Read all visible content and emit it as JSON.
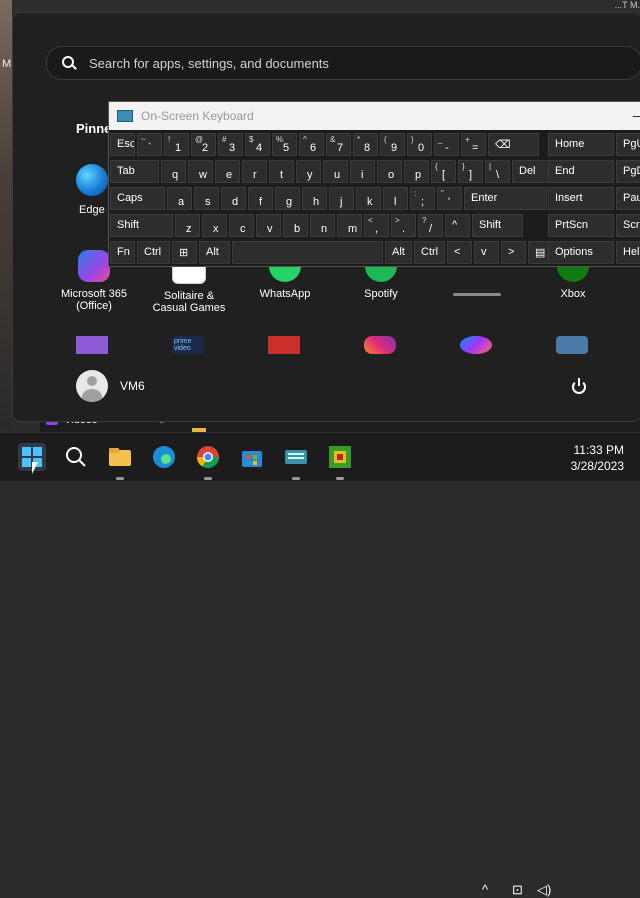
{
  "background": {
    "left_label": "M",
    "top_right_text": "...T M."
  },
  "start_menu": {
    "search_placeholder": "Search for apps, settings, and documents",
    "pinned_label": "Pinne",
    "apps": [
      {
        "label": "Edge",
        "icon": "edge-icon"
      },
      {
        "label": "Microsoft 365\n(Office)",
        "icon": "office-icon"
      },
      {
        "label": "Solitaire &\nCasual Games",
        "icon": "solitaire-icon"
      },
      {
        "label": "WhatsApp",
        "icon": "whatsapp-icon"
      },
      {
        "label": "Spotify",
        "icon": "spotify-icon"
      },
      {
        "label": "Xbox",
        "icon": "xbox-icon"
      }
    ],
    "user_name": "VM6"
  },
  "osk": {
    "title": "On-Screen Keyboard",
    "rows": [
      [
        {
          "t": "Esc",
          "w": true
        },
        {
          "s": "~",
          "m": "`"
        },
        {
          "s": "!",
          "m": "1"
        },
        {
          "s": "@",
          "m": "2"
        },
        {
          "s": "#",
          "m": "3"
        },
        {
          "s": "$",
          "m": "4"
        },
        {
          "s": "%",
          "m": "5"
        },
        {
          "s": "^",
          "m": "6"
        },
        {
          "s": "&",
          "m": "7"
        },
        {
          "s": "*",
          "m": "8"
        },
        {
          "s": "(",
          "m": "9"
        },
        {
          "s": ")",
          "m": "0"
        },
        {
          "s": "_",
          "m": "-"
        },
        {
          "s": "+",
          "m": "="
        },
        {
          "t": "⌫",
          "w": true
        }
      ],
      [
        {
          "t": "Tab",
          "w": true
        },
        {
          "m": "q"
        },
        {
          "m": "w"
        },
        {
          "m": "e"
        },
        {
          "m": "r"
        },
        {
          "m": "t"
        },
        {
          "m": "y"
        },
        {
          "m": "u"
        },
        {
          "m": "i"
        },
        {
          "m": "o"
        },
        {
          "m": "p"
        },
        {
          "s": "{",
          "m": "["
        },
        {
          "s": "}",
          "m": "]"
        },
        {
          "s": "|",
          "m": "\\"
        },
        {
          "t": "Del",
          "w": true
        }
      ],
      [
        {
          "t": "Caps",
          "w": true
        },
        {
          "m": "a"
        },
        {
          "m": "s"
        },
        {
          "m": "d"
        },
        {
          "m": "f"
        },
        {
          "m": "g"
        },
        {
          "m": "h"
        },
        {
          "m": "j"
        },
        {
          "m": "k"
        },
        {
          "m": "l"
        },
        {
          "s": ":",
          "m": ";"
        },
        {
          "s": "\"",
          "m": "'"
        },
        {
          "t": "Enter",
          "w": true
        }
      ],
      [
        {
          "t": "Shift",
          "w": true
        },
        {
          "m": "z"
        },
        {
          "m": "x"
        },
        {
          "m": "c"
        },
        {
          "m": "v"
        },
        {
          "m": "b"
        },
        {
          "m": "n"
        },
        {
          "m": "m"
        },
        {
          "s": "<",
          "m": ","
        },
        {
          "s": ">",
          "m": "."
        },
        {
          "s": "?",
          "m": "/"
        },
        {
          "t": "^",
          "w": true
        },
        {
          "t": "Shift",
          "w": true
        }
      ],
      [
        {
          "t": "Fn",
          "w": true
        },
        {
          "t": "Ctrl",
          "w": true
        },
        {
          "t": "⊞",
          "w": true
        },
        {
          "t": "Alt",
          "w": true
        },
        {
          "t": "",
          "w": true
        },
        {
          "t": "Alt",
          "w": true
        },
        {
          "t": "Ctrl",
          "w": true
        },
        {
          "t": "<",
          "w": true
        },
        {
          "t": "v",
          "w": true
        },
        {
          "t": ">",
          "w": true
        },
        {
          "t": "▤",
          "w": true
        }
      ]
    ],
    "nav": [
      [
        "Home",
        "PgU"
      ],
      [
        "End",
        "PgD"
      ],
      [
        "Insert",
        "Pau"
      ],
      [
        "PrtScn",
        "Scrl"
      ],
      [
        "Options",
        "Help"
      ]
    ]
  },
  "taskbar": {
    "time": "11:33 PM",
    "date": "3/28/2023",
    "tray_chevron": "^"
  },
  "colors": {
    "accent": "#0078d4",
    "start_bg": "#202020",
    "taskbar_bg": "#1c1c1c"
  }
}
